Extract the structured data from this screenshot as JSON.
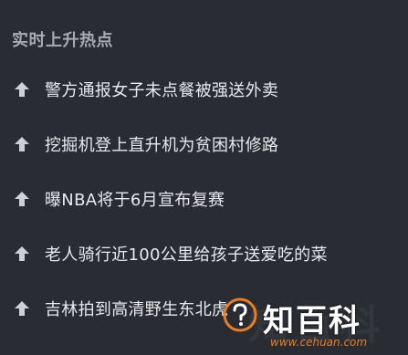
{
  "section": {
    "title": "实时上升热点"
  },
  "hot_list": [
    {
      "icon": "up-arrow-icon",
      "text": "警方通报女子未点餐被强送外卖"
    },
    {
      "icon": "up-arrow-icon",
      "text": "挖掘机登上直升机为贫困村修路"
    },
    {
      "icon": "up-arrow-icon",
      "text": "曝NBA将于6月宣布复赛"
    },
    {
      "icon": "up-arrow-icon",
      "text": "老人骑行近100公里给孩子送爱吃的菜"
    },
    {
      "icon": "up-arrow-icon",
      "text": "吉林拍到高清野生东北虎"
    }
  ],
  "watermark": {
    "brand": "知百科",
    "url": "www.cehuan.com",
    "accent_color": "#e67e22"
  },
  "colors": {
    "background": "#2a2c33",
    "title": "#a9aab0",
    "text": "#e9e9ec",
    "arrow": "#cfd0d4"
  }
}
